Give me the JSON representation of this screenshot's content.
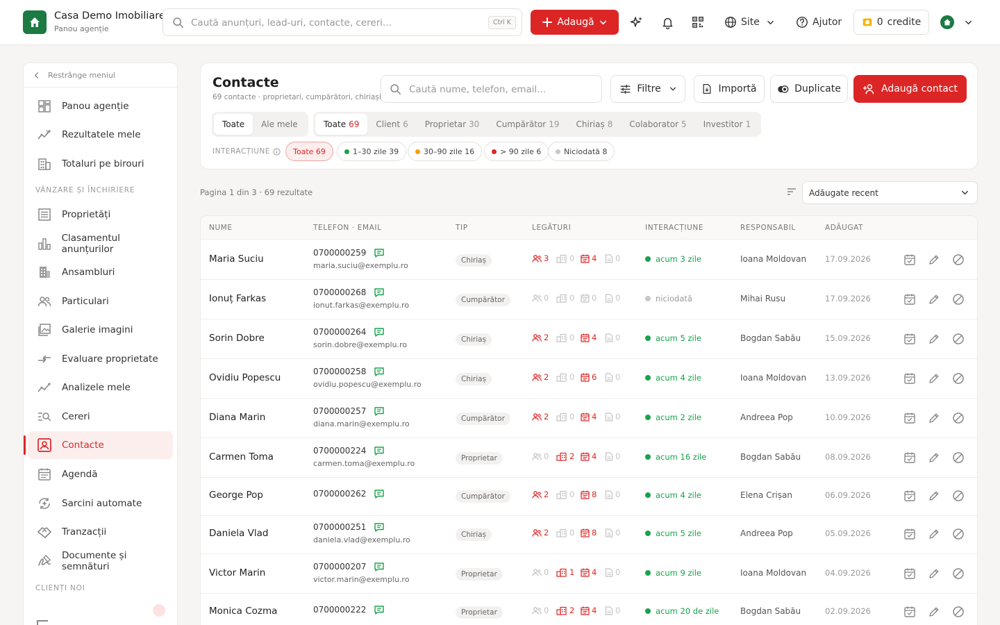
{
  "header": {
    "brand_name": "Casa Demo Imobiliare",
    "brand_sub": "Panou agenție",
    "search_placeholder": "Caută anunțuri, lead-uri, contacte, cereri...",
    "search_shortcut": "Ctrl K",
    "add_label": "Adaugă",
    "site_label": "Site",
    "help_label": "Ajutor",
    "credits_count": "0",
    "credits_label": "credite"
  },
  "sidebar": {
    "collapse_label": "Restrânge meniul",
    "items": [
      {
        "label": "Panou agenție",
        "icon": "dashboard-icon"
      },
      {
        "label": "Rezultatele mele",
        "icon": "trend-icon"
      },
      {
        "label": "Totaluri pe birouri",
        "icon": "office-icon"
      },
      {
        "label": "Proprietăți",
        "icon": "list-icon"
      },
      {
        "label": "Clasamentul anunțurilor",
        "icon": "bar-chart-icon"
      },
      {
        "label": "Ansambluri",
        "icon": "building-icon"
      },
      {
        "label": "Particulari",
        "icon": "people-icon"
      },
      {
        "label": "Galerie imagini",
        "icon": "image-icon"
      },
      {
        "label": "Evaluare proprietate",
        "icon": "arrows-icon"
      },
      {
        "label": "Analizele mele",
        "icon": "trend-icon"
      },
      {
        "label": "Cereri",
        "icon": "search-list-icon"
      },
      {
        "label": "Contacte",
        "icon": "contacts-icon"
      },
      {
        "label": "Agendă",
        "icon": "calendar-icon"
      },
      {
        "label": "Sarcini automate",
        "icon": "automation-icon"
      },
      {
        "label": "Tranzacții",
        "icon": "handshake-icon"
      },
      {
        "label": "Documente și semnături",
        "icon": "signature-icon"
      }
    ],
    "sections": {
      "sales": "VÂNZARE ȘI ÎNCHIRIERE",
      "clients": "CLIENȚI NOI"
    }
  },
  "page": {
    "title": "Contacte",
    "subtitle": "69 contacte · proprietari, cumpărători, chiriași",
    "search_placeholder": "Caută nume, telefon, email...",
    "filters_label": "Filtre",
    "import_label": "Importă",
    "duplicates_label": "Duplicate",
    "add_contact_label": "Adaugă contact",
    "owner_tabs": [
      {
        "label": "Toate"
      },
      {
        "label": "Ale mele"
      }
    ],
    "type_tabs": [
      {
        "label": "Toate",
        "count": "69"
      },
      {
        "label": "Client",
        "count": "6"
      },
      {
        "label": "Proprietar",
        "count": "30"
      },
      {
        "label": "Cumpărător",
        "count": "19"
      },
      {
        "label": "Chiriaș",
        "count": "8"
      },
      {
        "label": "Colaborator",
        "count": "5"
      },
      {
        "label": "Investitor",
        "count": "1"
      }
    ],
    "interaction_label": "INTERACȚIUNE",
    "interaction_chips": [
      {
        "label": "Toate 69",
        "color": ""
      },
      {
        "label": "1–30 zile 39",
        "color": "#16a34a"
      },
      {
        "label": "30–90 zile 16",
        "color": "#f59e0b"
      },
      {
        "label": "> 90 zile 6",
        "color": "#dc2626"
      },
      {
        "label": "Niciodată 8",
        "color": "#c9c6c4"
      }
    ],
    "results_info": "Pagina 1 din 3 · 69 rezultate",
    "sort_value": "Adăugate recent"
  },
  "table": {
    "headers": {
      "name": "NUME",
      "phone_email": "TELEFON · EMAIL",
      "type": "TIP",
      "links": "LEGĂTURI",
      "interaction": "INTERACȚIUNE",
      "responsible": "RESPONSABIL",
      "added": "ADĂUGAT"
    },
    "rows": [
      {
        "name": "Maria Suciu",
        "phone": "0700000259",
        "email": "maria.suciu@exemplu.ro",
        "type": "Chiriaș",
        "links": [
          "3",
          "0",
          "4",
          "0"
        ],
        "interaction": "acum 3 zile",
        "interaction_color": "#16a34a",
        "responsible": "Ioana Moldovan",
        "added": "17.09.2026"
      },
      {
        "name": "Ionuț Farkas",
        "phone": "0700000268",
        "email": "ionut.farkas@exemplu.ro",
        "type": "Cumpărător",
        "links": [
          "0",
          "0",
          "0",
          "0"
        ],
        "interaction": "niciodată",
        "interaction_color": "#c9c6c4",
        "responsible": "Mihai Rusu",
        "added": "17.09.2026"
      },
      {
        "name": "Sorin Dobre",
        "phone": "0700000264",
        "email": "sorin.dobre@exemplu.ro",
        "type": "Chiriaș",
        "links": [
          "2",
          "0",
          "4",
          "0"
        ],
        "interaction": "acum 5 zile",
        "interaction_color": "#16a34a",
        "responsible": "Bogdan Sabău",
        "added": "15.09.2026"
      },
      {
        "name": "Ovidiu Popescu",
        "phone": "0700000258",
        "email": "ovidiu.popescu@exemplu.ro",
        "type": "Chiriaș",
        "links": [
          "2",
          "0",
          "6",
          "0"
        ],
        "interaction": "acum 4 zile",
        "interaction_color": "#16a34a",
        "responsible": "Ioana Moldovan",
        "added": "13.09.2026"
      },
      {
        "name": "Diana Marin",
        "phone": "0700000257",
        "email": "diana.marin@exemplu.ro",
        "type": "Cumpărător",
        "links": [
          "2",
          "0",
          "4",
          "0"
        ],
        "interaction": "acum 2 zile",
        "interaction_color": "#16a34a",
        "responsible": "Andreea Pop",
        "added": "10.09.2026"
      },
      {
        "name": "Carmen Toma",
        "phone": "0700000224",
        "email": "carmen.toma@exemplu.ro",
        "type": "Proprietar",
        "links": [
          "0",
          "2",
          "4",
          "0"
        ],
        "interaction": "acum 16 zile",
        "interaction_color": "#16a34a",
        "responsible": "Bogdan Sabău",
        "added": "08.09.2026"
      },
      {
        "name": "George Pop",
        "phone": "0700000262",
        "email": "",
        "type": "Cumpărător",
        "links": [
          "2",
          "0",
          "8",
          "0"
        ],
        "interaction": "acum 4 zile",
        "interaction_color": "#16a34a",
        "responsible": "Elena Crișan",
        "added": "06.09.2026"
      },
      {
        "name": "Daniela Vlad",
        "phone": "0700000251",
        "email": "daniela.vlad@exemplu.ro",
        "type": "Chiriaș",
        "links": [
          "2",
          "0",
          "8",
          "0"
        ],
        "interaction": "acum 5 zile",
        "interaction_color": "#16a34a",
        "responsible": "Andreea Pop",
        "added": "05.09.2026"
      },
      {
        "name": "Victor Marin",
        "phone": "0700000207",
        "email": "victor.marin@exemplu.ro",
        "type": "Proprietar",
        "links": [
          "0",
          "1",
          "4",
          "0"
        ],
        "interaction": "acum 9 zile",
        "interaction_color": "#16a34a",
        "responsible": "Ioana Moldovan",
        "added": "04.09.2026"
      },
      {
        "name": "Monica Cozma",
        "phone": "0700000222",
        "email": "",
        "type": "Proprietar",
        "links": [
          "0",
          "2",
          "4",
          "0"
        ],
        "interaction": "acum 20 de zile",
        "interaction_color": "#16a34a",
        "responsible": "Bogdan Sabău",
        "added": "02.09.2026"
      }
    ]
  },
  "colors": {
    "accent": "#dc2626",
    "brand": "#1c7a43",
    "success": "#16a34a"
  }
}
